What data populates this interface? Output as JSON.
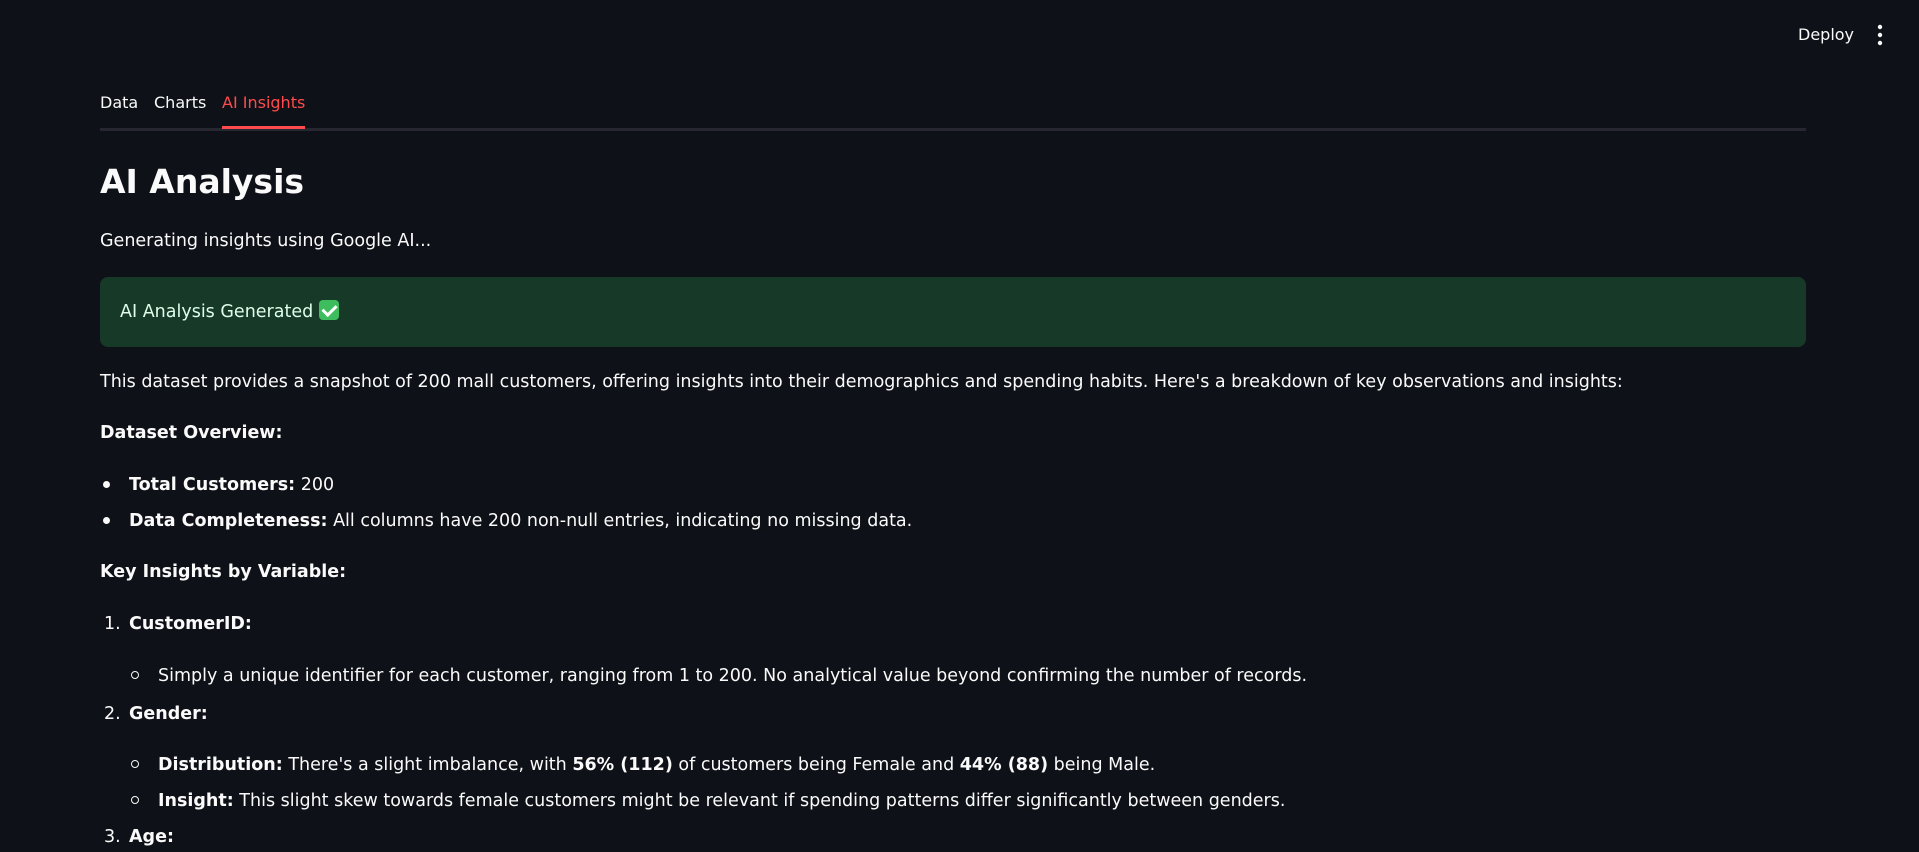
{
  "header": {
    "deploy_label": "Deploy",
    "menu_icon": "kebab-menu-icon"
  },
  "tabs": [
    {
      "label": "Data"
    },
    {
      "label": "Charts"
    },
    {
      "label": "AI Insights"
    }
  ],
  "active_tab": "AI Insights",
  "page_title": "AI Analysis",
  "status_text": "Generating insights using Google AI...",
  "success": {
    "text": "AI Analysis Generated",
    "icon": "check-mark-icon",
    "color": "#173928"
  },
  "intro": "This dataset provides a snapshot of 200 mall customers, offering insights into their demographics and spending habits. Here's a breakdown of key observations and insights:",
  "overview": {
    "heading": "Dataset Overview:",
    "items": [
      {
        "label": "Total Customers:",
        "text": " 200"
      },
      {
        "label": "Data Completeness:",
        "text": " All columns have 200 non-null entries, indicating no missing data."
      }
    ]
  },
  "insights": {
    "heading": "Key Insights by Variable:",
    "sections": [
      {
        "number": "1.",
        "title": "CustomerID:",
        "items": [
          {
            "text": "Simply a unique identifier for each customer, ranging from 1 to 200. No analytical value beyond confirming the number of records."
          }
        ]
      },
      {
        "number": "2.",
        "title": "Gender:",
        "items": [
          {
            "label": "Distribution:",
            "t1": " There's a slight imbalance, with ",
            "b1": "56% (112)",
            "t2": " of customers being Female and ",
            "b2": "44% (88)",
            "t3": " being Male."
          },
          {
            "label": "Insight:",
            "text": " This slight skew towards female customers might be relevant if spending patterns differ significantly between genders."
          }
        ]
      },
      {
        "number": "3.",
        "title": "Age:"
      }
    ]
  },
  "colors": {
    "accent": "#ff4b4b",
    "background": "#0e1117",
    "success_bg": "#173928"
  }
}
